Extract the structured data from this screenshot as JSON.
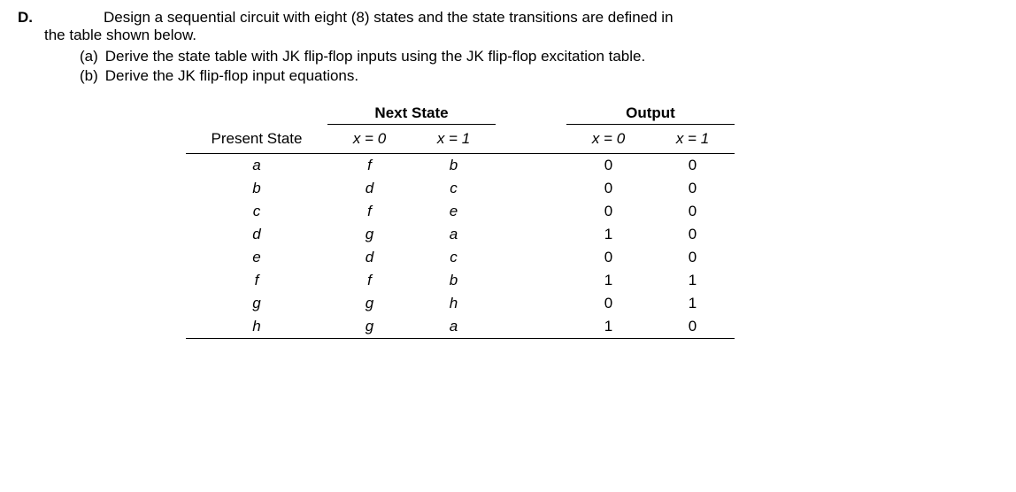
{
  "problem": {
    "letter": "D.",
    "textLine1": "Design a sequential circuit with eight (8) states and the state transitions are defined in",
    "textLine2": "the table shown below.",
    "parts": [
      {
        "label": "(a)",
        "text": "Derive the state table with JK flip-flop inputs using the JK flip-flop excitation table."
      },
      {
        "label": "(b)",
        "text": "Derive the JK flip-flop input equations."
      }
    ]
  },
  "table": {
    "headers": {
      "present": "Present State",
      "nextState": "Next State",
      "output": "Output",
      "x0": "x = 0",
      "x1": "x = 1"
    },
    "rows": [
      {
        "present": "a",
        "ns0": "f",
        "ns1": "b",
        "out0": "0",
        "out1": "0"
      },
      {
        "present": "b",
        "ns0": "d",
        "ns1": "c",
        "out0": "0",
        "out1": "0"
      },
      {
        "present": "c",
        "ns0": "f",
        "ns1": "e",
        "out0": "0",
        "out1": "0"
      },
      {
        "present": "d",
        "ns0": "g",
        "ns1": "a",
        "out0": "1",
        "out1": "0"
      },
      {
        "present": "e",
        "ns0": "d",
        "ns1": "c",
        "out0": "0",
        "out1": "0"
      },
      {
        "present": "f",
        "ns0": "f",
        "ns1": "b",
        "out0": "1",
        "out1": "1"
      },
      {
        "present": "g",
        "ns0": "g",
        "ns1": "h",
        "out0": "0",
        "out1": "1"
      },
      {
        "present": "h",
        "ns0": "g",
        "ns1": "a",
        "out0": "1",
        "out1": "0"
      }
    ]
  }
}
